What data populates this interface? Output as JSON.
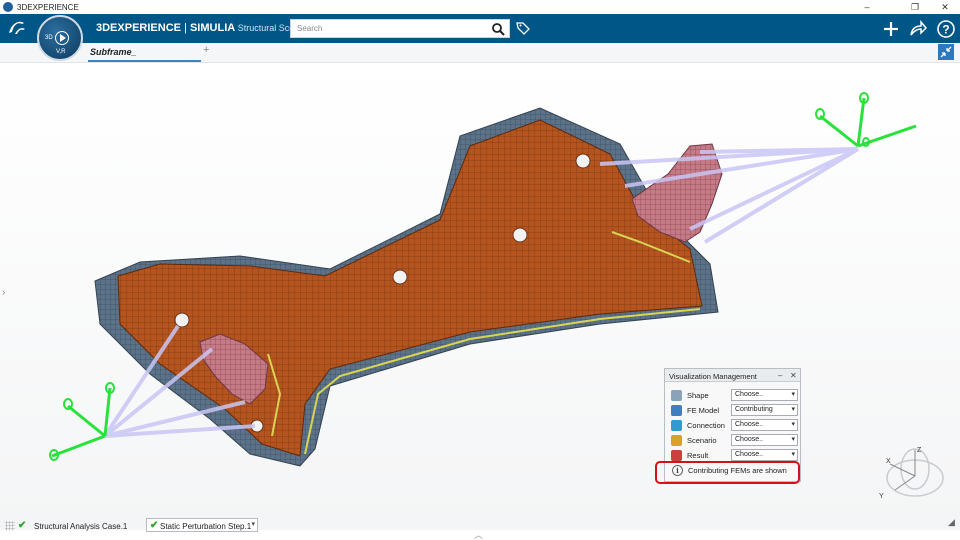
{
  "window": {
    "title": "3DEXPERIENCE",
    "controls": [
      "–",
      "❐",
      "✕"
    ]
  },
  "header": {
    "brand_bold": "3DEXPERIENCE",
    "brand_sep": " | ",
    "brand_app": "SIMULIA",
    "brand_sub": " Structural Scenari..",
    "search_placeholder": "Search",
    "compass": {
      "label_3d": "3D",
      "version": "V,R"
    },
    "icons": [
      "search-icon",
      "tag-icon",
      "add-icon",
      "share-icon",
      "help-icon"
    ]
  },
  "tabs": {
    "active": "Subframe_",
    "add_label": "+"
  },
  "viewport": {
    "left_arrow": "›",
    "mesh_color": "#b5541e",
    "base_color": "#5b7288",
    "beam_color": "#c9c6f5",
    "axes_color": "#28e23a",
    "triad_labels": {
      "x": "X",
      "y": "Y",
      "z": "Z"
    }
  },
  "viz_panel": {
    "title": "Visualization Management",
    "minimize": "–",
    "close": "✕",
    "rows": [
      {
        "label": "Shape",
        "value": "Choose..",
        "icon": "shape-icon",
        "color": "#8aa3b8"
      },
      {
        "label": "FE Model",
        "value": "Contributing",
        "icon": "fe-model-icon",
        "color": "#3f7fc0"
      },
      {
        "label": "Connection",
        "value": "Choose..",
        "icon": "connection-icon",
        "color": "#2f9bd1"
      },
      {
        "label": "Scenario",
        "value": "Choose..",
        "icon": "scenario-icon",
        "color": "#d8a12a"
      },
      {
        "label": "Result",
        "value": "Choose..",
        "icon": "result-icon",
        "color": "#c9413a"
      }
    ],
    "info_text": "Contributing FEMs are shown",
    "highlight_color": "#d31119"
  },
  "status": {
    "case": "Structural Analysis Case.1",
    "step": "Static Perturbation Step.1",
    "check_color": "#2aa82a"
  }
}
